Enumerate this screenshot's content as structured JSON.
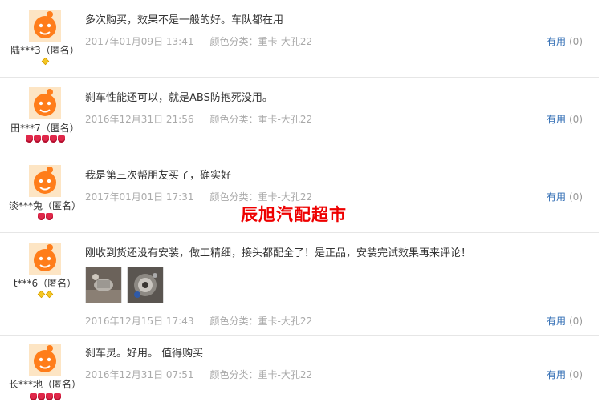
{
  "watermark": "辰旭汽配超市",
  "useful_label": "有用",
  "colors": {
    "accent": "#2e6bb3",
    "badge_red": "#e0284a",
    "badge_gold": "#f3c623",
    "watermark": "#e00000"
  },
  "reviews": [
    {
      "user": "陆***3（匿名）",
      "text": "多次购买，效果不是一般的好。车队都在用",
      "time": "2017年01月09日 13:41",
      "color": "颜色分类：重卡-大孔22",
      "useful": "(0)",
      "badges": [
        "gold"
      ]
    },
    {
      "user": "田***7（匿名）",
      "text": "刹车性能还可以，就是ABS防抱死没用。",
      "time": "2016年12月31日 21:56",
      "color": "颜色分类：重卡-大孔22",
      "useful": "(0)",
      "badges": [
        "heart",
        "heart",
        "heart",
        "heart",
        "heart"
      ]
    },
    {
      "user": "淡***兔（匿名）",
      "text": "我是第三次帮朋友买了，确实好",
      "time": "2017年01月01日 17:31",
      "color": "颜色分类：重卡-大孔22",
      "useful": "(0)",
      "badges": [
        "heart",
        "heart"
      ]
    },
    {
      "user": "t***6（匿名）",
      "text": "刚收到货还没有安装，做工精细，接头都配全了！是正品，安装完试效果再来评论！",
      "time": "2016年12月15日 17:43",
      "color": "颜色分类：重卡-大孔22",
      "useful": "(0)",
      "badges": [
        "gold",
        "gold"
      ],
      "photos": [
        "photo-1",
        "photo-2"
      ]
    },
    {
      "user": "长***地（匿名）",
      "text": "刹车灵。好用。 值得购买",
      "time": "2016年12月31日 07:51",
      "color": "颜色分类：重卡-大孔22",
      "useful": "(0)",
      "badges": [
        "heart",
        "heart",
        "heart",
        "heart"
      ]
    }
  ]
}
